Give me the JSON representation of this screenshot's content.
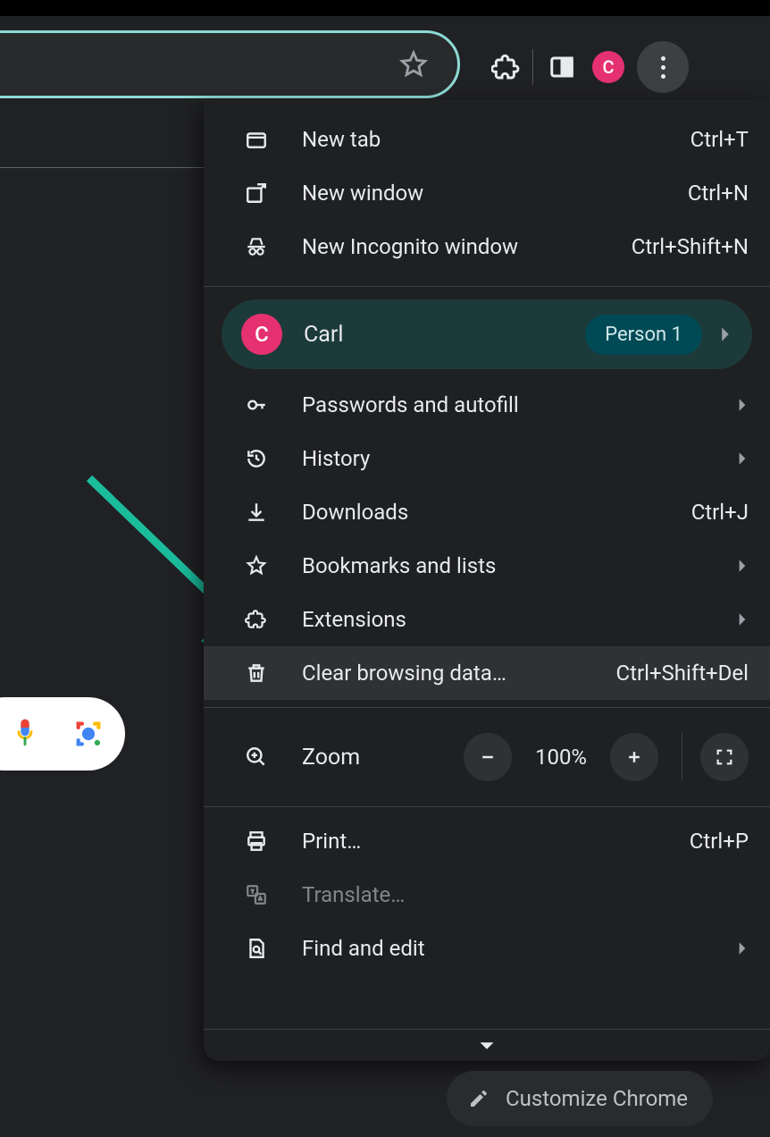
{
  "toolbar": {
    "avatar_letter": "C"
  },
  "menu": {
    "new_tab": {
      "label": "New tab",
      "shortcut": "Ctrl+T"
    },
    "new_window": {
      "label": "New window",
      "shortcut": "Ctrl+N"
    },
    "incognito": {
      "label": "New Incognito window",
      "shortcut": "Ctrl+Shift+N"
    },
    "profile": {
      "name": "Carl",
      "badge": "Person 1",
      "avatar_letter": "C"
    },
    "passwords": {
      "label": "Passwords and autofill"
    },
    "history": {
      "label": "History"
    },
    "downloads": {
      "label": "Downloads",
      "shortcut": "Ctrl+J"
    },
    "bookmarks": {
      "label": "Bookmarks and lists"
    },
    "extensions": {
      "label": "Extensions"
    },
    "clear": {
      "label": "Clear browsing data…",
      "shortcut": "Ctrl+Shift+Del"
    },
    "zoom": {
      "label": "Zoom",
      "value": "100%"
    },
    "print": {
      "label": "Print…",
      "shortcut": "Ctrl+P"
    },
    "translate": {
      "label": "Translate…"
    },
    "find": {
      "label": "Find and edit"
    }
  },
  "customize_label": "Customize Chrome",
  "annotation": {
    "arrow_color": "#1abc9c"
  }
}
